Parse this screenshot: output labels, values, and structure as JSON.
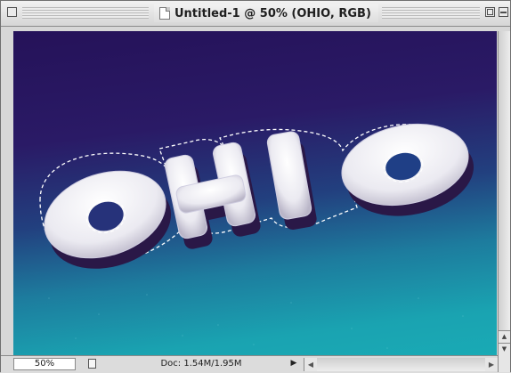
{
  "window": {
    "title": "Untitled-1 @ 50% (OHIO, RGB)"
  },
  "canvas": {
    "text": "OHIO",
    "colors": {
      "bg_top": "#251259",
      "bg_bottom": "#19aab5",
      "letter_fill": "#f2f2f6",
      "letter_shadow": "#2a1847",
      "selection": "#ffffff"
    }
  },
  "statusbar": {
    "zoom": "50%",
    "doc_size": "Doc: 1.54M/1.95M"
  },
  "icons": {
    "close": "close-box-icon",
    "zoom": "zoom-box-icon",
    "collapse": "collapse-box-icon",
    "document": "document-icon",
    "file_info": "file-info-icon",
    "popup": "triangle-right-icon"
  }
}
